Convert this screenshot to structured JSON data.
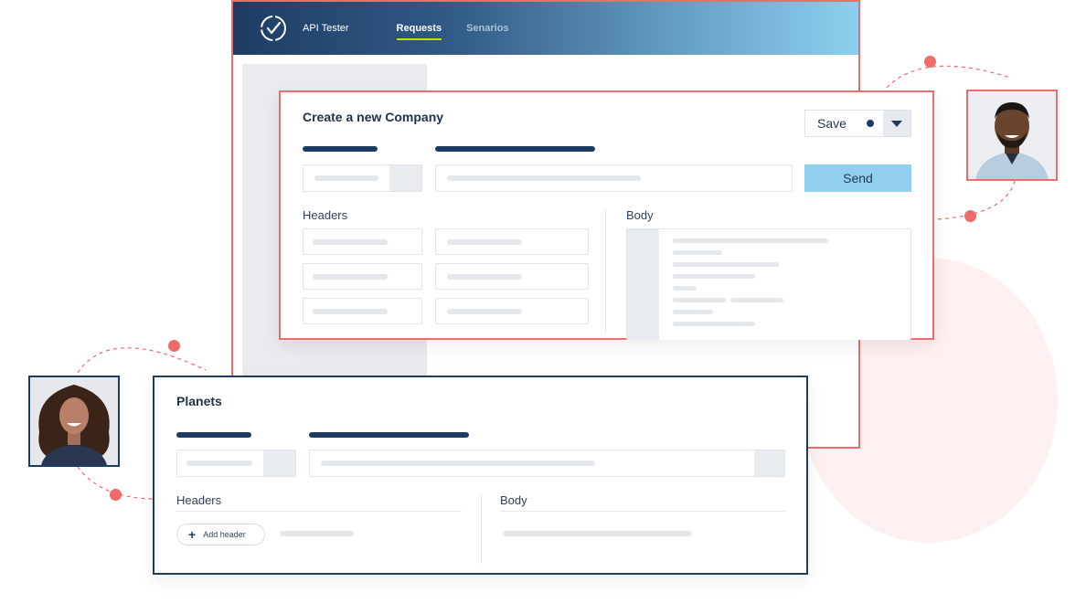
{
  "app": {
    "title": "API Tester",
    "tabs": [
      {
        "label": "Requests",
        "active": true
      },
      {
        "label": "Senarios",
        "active": false
      }
    ]
  },
  "request_card": {
    "title": "Create a new Company",
    "save_label": "Save",
    "send_label": "Send",
    "headers_label": "Headers",
    "body_label": "Body"
  },
  "planets_card": {
    "title": "Planets",
    "headers_label": "Headers",
    "body_label": "Body",
    "add_header_label": "Add header"
  },
  "colors": {
    "accent_red": "#f06b6b",
    "brand_navy": "#1d3c64",
    "send_blue": "#90cfed",
    "tab_underline": "#c4e000"
  }
}
